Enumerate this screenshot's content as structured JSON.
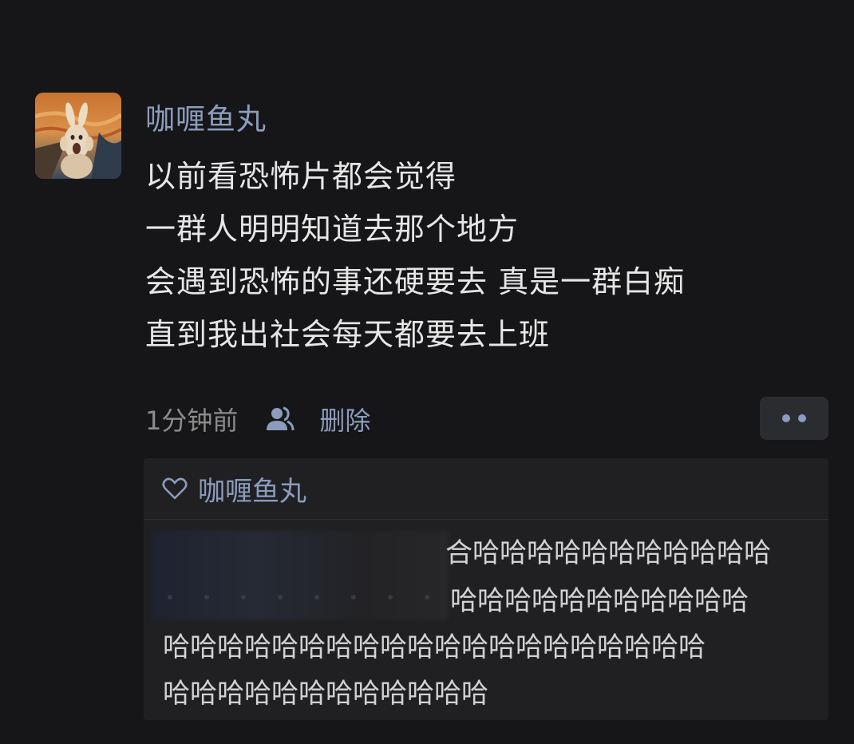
{
  "post": {
    "author": "咖喱鱼丸",
    "avatar_icon": "screaming-rabbit-avatar",
    "lines": [
      "以前看恐怖片都会觉得",
      "一群人明明知道去那个地方",
      "会遇到恐怖的事还硬要去 真是一群白痴",
      "直到我出社会每天都要去上班"
    ],
    "time": "1分钟前",
    "visibility_icon": "friends-visibility-icon",
    "delete_label": "删除",
    "more_icon": "more-dots-icon"
  },
  "likes": {
    "icon": "heart-icon",
    "names": "咖喱鱼丸"
  },
  "comment": {
    "lines": [
      "合哈哈哈哈哈哈哈哈哈哈哈",
      "哈哈哈哈哈哈哈哈哈哈哈",
      "哈哈哈哈哈哈哈哈哈哈哈哈哈哈哈哈哈哈哈哈",
      "哈哈哈哈哈哈哈哈哈哈哈哈"
    ]
  },
  "colors": {
    "background": "#161618",
    "link": "#8b9cbd",
    "text": "#e6e6e6",
    "panel": "#202022"
  }
}
